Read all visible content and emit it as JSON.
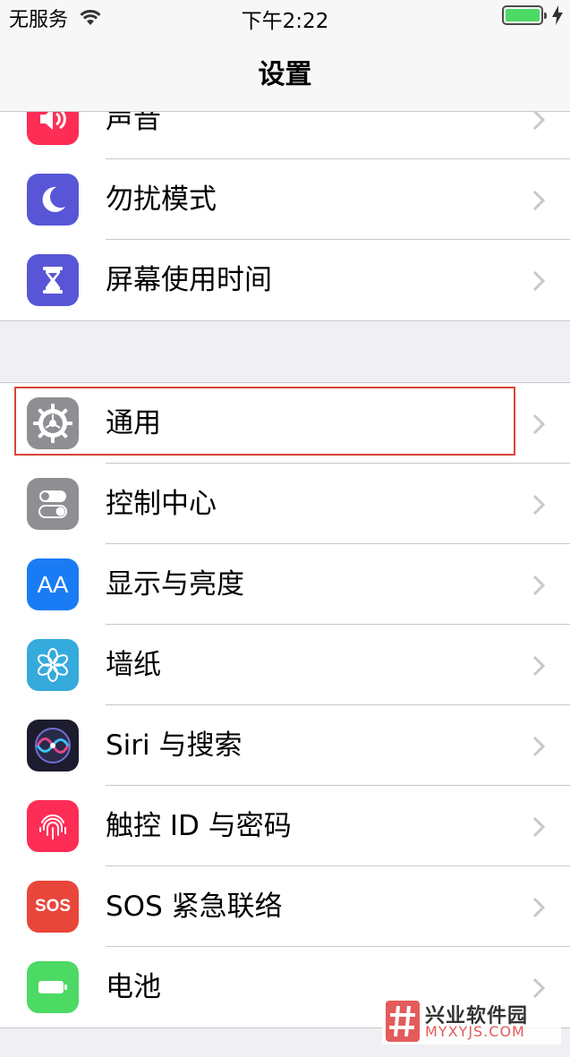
{
  "status_bar": {
    "carrier": "无服务",
    "time": "下午2:22",
    "battery_color": "#4cd964"
  },
  "nav": {
    "title": "设置"
  },
  "group_top": [
    {
      "label": "声音",
      "icon": "sound-icon",
      "color": "#fe2d55"
    },
    {
      "label": "勿扰模式",
      "icon": "moon-icon",
      "color": "#5856d6"
    },
    {
      "label": "屏幕使用时间",
      "icon": "hourglass-icon",
      "color": "#5856d6"
    }
  ],
  "group_main": [
    {
      "label": "通用",
      "icon": "gear-icon",
      "color": "#8e8e93"
    },
    {
      "label": "控制中心",
      "icon": "toggles-icon",
      "color": "#8e8e93"
    },
    {
      "label": "显示与亮度",
      "icon": "text-size-icon",
      "color": "#1a7cf5"
    },
    {
      "label": "墙纸",
      "icon": "flower-icon",
      "color": "#35aadc"
    },
    {
      "label": "Siri 与搜索",
      "icon": "siri-icon",
      "color": "#1c1c2e"
    },
    {
      "label": "触控 ID 与密码",
      "icon": "fingerprint-icon",
      "color": "#fe2d55"
    },
    {
      "label": "SOS 紧急联络",
      "icon": "sos-icon",
      "color": "#e8463a"
    },
    {
      "label": "电池",
      "icon": "battery-icon",
      "color": "#4cd964"
    }
  ],
  "icon_text": {
    "text_size": "AA",
    "sos": "SOS"
  },
  "watermark": {
    "name": "兴业软件园",
    "domain": "MYXYJS.COM"
  }
}
